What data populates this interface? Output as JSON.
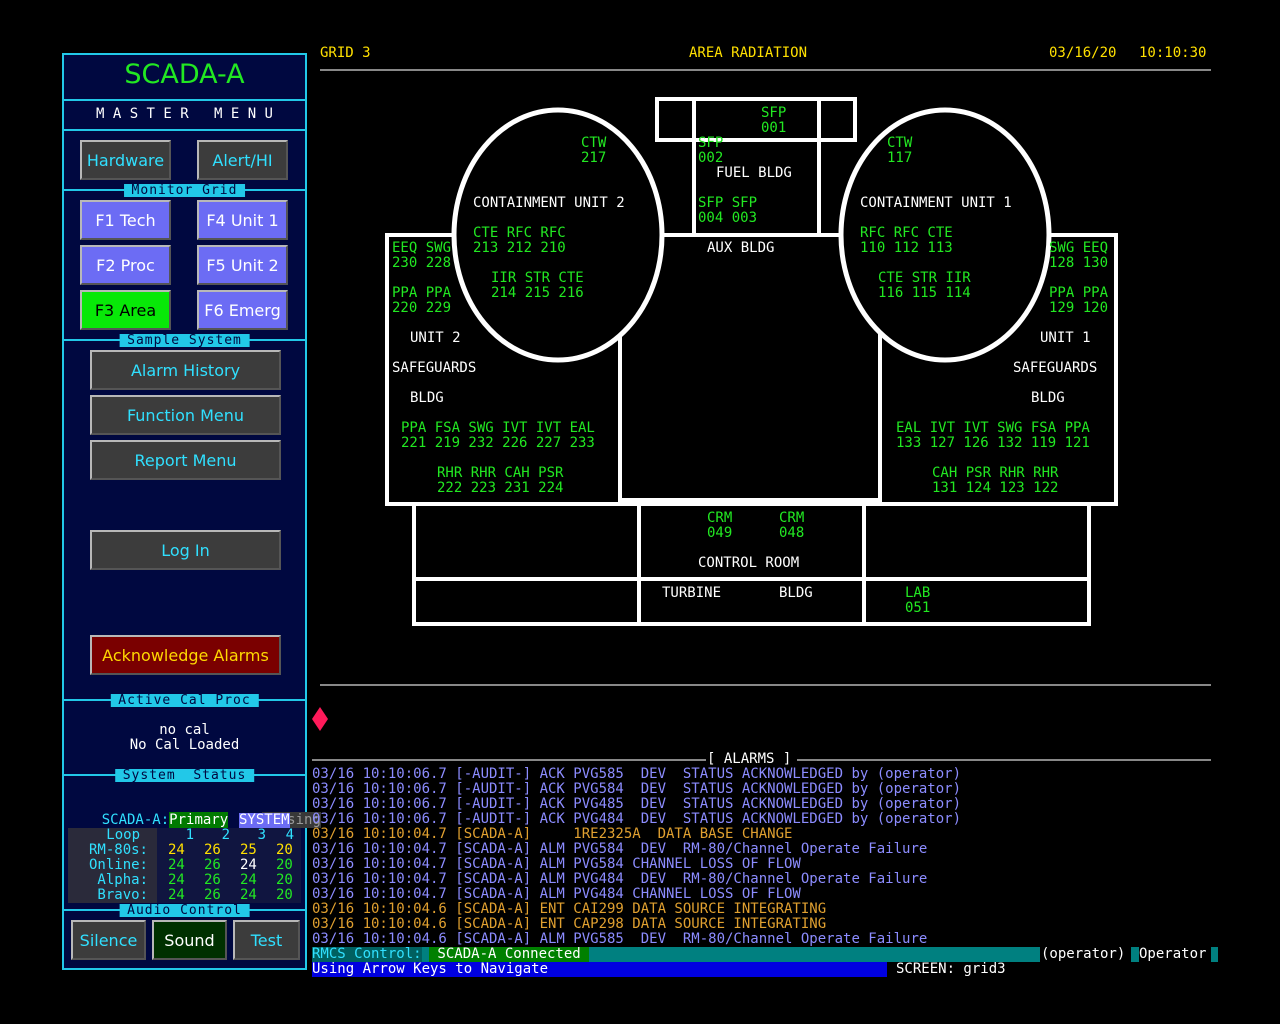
{
  "sidebar": {
    "title": "SCADA-A",
    "master_menu": "M A S T E R   M E N U",
    "hardware": "Hardware",
    "alert": "Alert/HI",
    "monitor_grid_header": "Monitor Grid",
    "f1": "F1 Tech",
    "f2": "F2 Proc",
    "f3": "F3 Area",
    "f4": "F4 Unit 1",
    "f5": "F5 Unit 2",
    "f6": "F6 Emerg",
    "sample_system_header": "Sample System",
    "alarm_history": "Alarm History",
    "function_menu": "Function Menu",
    "report_menu": "Report Menu",
    "log_in": "Log In",
    "ack_alarms": "Acknowledge Alarms",
    "active_cal_header": "Active Cal Proc",
    "cal_line1": "no cal",
    "cal_line2": "No Cal Loaded",
    "system_status_header": "System  Status",
    "scada_a_label": "SCADA-A:",
    "scada_a_value": "Primary",
    "scada_b_label": " -B:",
    "scada_b_value": "Missing",
    "system_badge": "SYSTEM",
    "loop_table": {
      "headers": [
        "Loop",
        "1",
        "2",
        "3",
        "4"
      ],
      "rows": [
        {
          "label": "RM-80s:",
          "values": [
            "24",
            "26",
            "25",
            "20"
          ]
        },
        {
          "label": "Online:",
          "values": [
            "24",
            "26",
            "24",
            "20"
          ]
        },
        {
          "label": "Alpha:",
          "values": [
            "24",
            "26",
            "24",
            "20"
          ]
        },
        {
          "label": "Bravo:",
          "values": [
            "24",
            "26",
            "24",
            "20"
          ]
        }
      ]
    },
    "audio_control_header": "Audio Control",
    "silence": "Silence",
    "sound": "Sound",
    "test": "Test"
  },
  "header": {
    "grid": "GRID 3",
    "title": "AREA RADIATION",
    "date": "03/16/20",
    "time": "10:10:30"
  },
  "map": {
    "fuel_bldg": "FUEL BLDG",
    "aux_bldg": "AUX BLDG",
    "containment_2": "CONTAINMENT UNIT 2",
    "containment_1": "CONTAINMENT UNIT 1",
    "unit2": "UNIT 2",
    "unit1": "UNIT 1",
    "safeguards": "SAFEGUARDS",
    "bldg": "BLDG",
    "control_room": "CONTROL ROOM",
    "turbine": "TURBINE",
    "turbine_bldg": "BLDG",
    "sfp001": "SFP\n001",
    "sfp002": "SFP\n002",
    "sfp004_003": "SFP SFP\n004 003",
    "ctw217": "CTW\n217",
    "ctw117": "CTW\n117",
    "c2_row1": "CTE RFC RFC\n213 212 210",
    "c2_row2": "IIR STR CTE\n214 215 216",
    "c1_row1": "RFC RFC CTE\n110 112 113",
    "c1_row2": "CTE STR IIR\n116 115 114",
    "u2_eeq": "EEQ SWG\n230 228",
    "u2_ppa": "PPA PPA\n220 229",
    "u1_swg": "SWG EEQ\n128 130",
    "u1_ppa": "PPA PPA\n129 120",
    "u2_row1": "PPA FSA SWG IVT IVT EAL\n221 219 232 226 227 233",
    "u2_row2": "RHR RHR CAH PSR\n222 223 231 224",
    "u1_row1": "EAL IVT IVT SWG FSA PPA\n133 127 126 132 119 121",
    "u1_row2": "CAH PSR RHR RHR\n131 124 123 122",
    "crm049": "CRM\n049",
    "crm048": "CRM\n048",
    "lab051": "LAB\n051"
  },
  "alarms": {
    "title": "[ ALARMS ]",
    "lines": [
      {
        "text": "03/16 10:10:06.7 [-AUDIT-] ACK PVG585  DEV  STATUS ACKNOWLEDGED by (operator)",
        "color": "#8c8cff"
      },
      {
        "text": "03/16 10:10:06.7 [-AUDIT-] ACK PVG584  DEV  STATUS ACKNOWLEDGED by (operator)",
        "color": "#8c8cff"
      },
      {
        "text": "03/16 10:10:06.7 [-AUDIT-] ACK PVG485  DEV  STATUS ACKNOWLEDGED by (operator)",
        "color": "#8c8cff"
      },
      {
        "text": "03/16 10:10:06.7 [-AUDIT-] ACK PVG484  DEV  STATUS ACKNOWLEDGED by (operator)",
        "color": "#8c8cff"
      },
      {
        "text": "03/16 10:10:04.7 [SCADA-A]     1RE2325A  DATA BASE CHANGE",
        "color": "#e0a030"
      },
      {
        "text": "03/16 10:10:04.7 [SCADA-A] ALM PVG584  DEV  RM-80/Channel Operate Failure",
        "color": "#8c8cff"
      },
      {
        "text": "03/16 10:10:04.7 [SCADA-A] ALM PVG584 CHANNEL LOSS OF FLOW",
        "color": "#8c8cff"
      },
      {
        "text": "03/16 10:10:04.7 [SCADA-A] ALM PVG484  DEV  RM-80/Channel Operate Failure",
        "color": "#8c8cff"
      },
      {
        "text": "03/16 10:10:04.7 [SCADA-A] ALM PVG484 CHANNEL LOSS OF FLOW",
        "color": "#8c8cff"
      },
      {
        "text": "03/16 10:10:04.6 [SCADA-A] ENT CAI299 DATA SOURCE INTEGRATING",
        "color": "#e0a030"
      },
      {
        "text": "03/16 10:10:04.6 [SCADA-A] ENT CAP298 DATA SOURCE INTEGRATING",
        "color": "#e0a030"
      },
      {
        "text": "03/16 10:10:04.6 [SCADA-A] ALM PVG585  DEV  RM-80/Channel Operate Failure",
        "color": "#8c8cff"
      }
    ]
  },
  "statusbar": {
    "rmcs_label": "RMCS Control:",
    "rmcs_value": " SCADA-A Connected",
    "user": "(operator)",
    "role": "Operator",
    "hint": "Using Arrow Keys to Navigate",
    "screen": "SCREEN: grid3"
  },
  "colors": {
    "panel_bg": "#000840",
    "panel_border": "#22c8e8",
    "sensor_green": "#22e822",
    "header_yellow": "#ffe000",
    "alarm_blue": "#8c8cff",
    "alarm_orange": "#e0a030"
  }
}
